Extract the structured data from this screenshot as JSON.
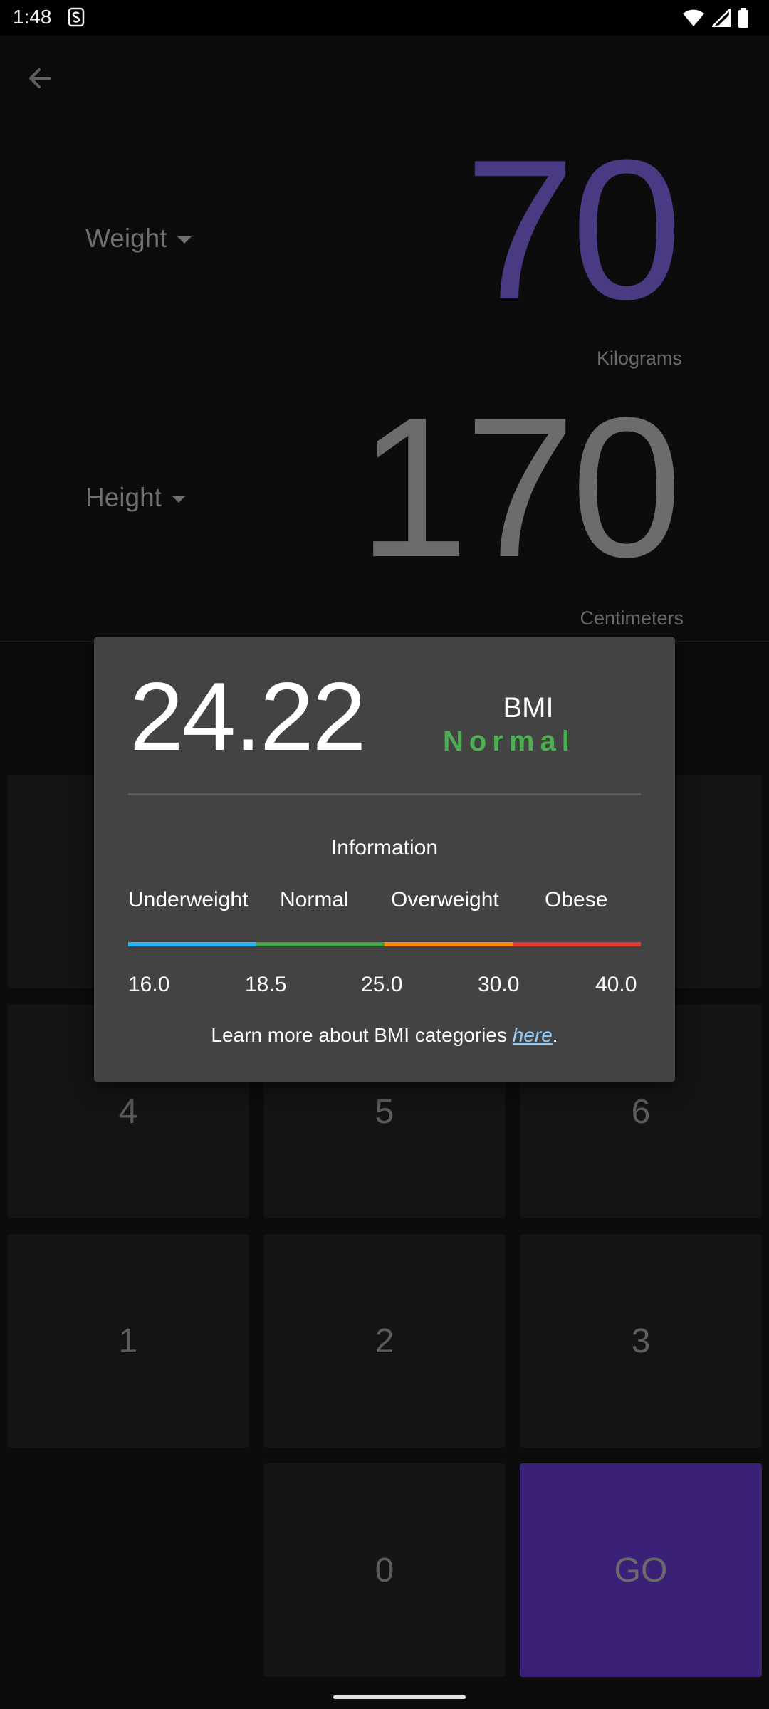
{
  "status_bar": {
    "time": "1:48",
    "app_icon": "s-app-icon",
    "icons": [
      "wifi-icon",
      "signal-icon",
      "battery-icon"
    ]
  },
  "nav": {
    "back_icon": "arrow-left-icon"
  },
  "weight": {
    "label": "Weight",
    "value": "70",
    "unit": "Kilograms",
    "value_color": "#4a3a83"
  },
  "height": {
    "label": "Height",
    "value": "170",
    "unit": "Centimeters"
  },
  "keypad": {
    "keys": [
      "4",
      "5",
      "6",
      "1",
      "2",
      "3",
      "0"
    ],
    "go_label": "GO",
    "go_color": "#3a2177"
  },
  "dialog": {
    "bmi_value": "24.22",
    "bmi_label": "BMI",
    "category": "Normal",
    "category_color": "#4caf50",
    "info_title": "Information",
    "categories": [
      "Underweight",
      "Normal",
      "Overweight",
      "Obese"
    ],
    "scale_colors": [
      "#29b6f6",
      "#43a047",
      "#fb8c00",
      "#e53935"
    ],
    "thresholds": [
      "16.0",
      "18.5",
      "25.0",
      "30.0",
      "40.0"
    ],
    "learn_prefix": "Learn more about BMI categories ",
    "learn_link": "here",
    "learn_suffix": "."
  }
}
